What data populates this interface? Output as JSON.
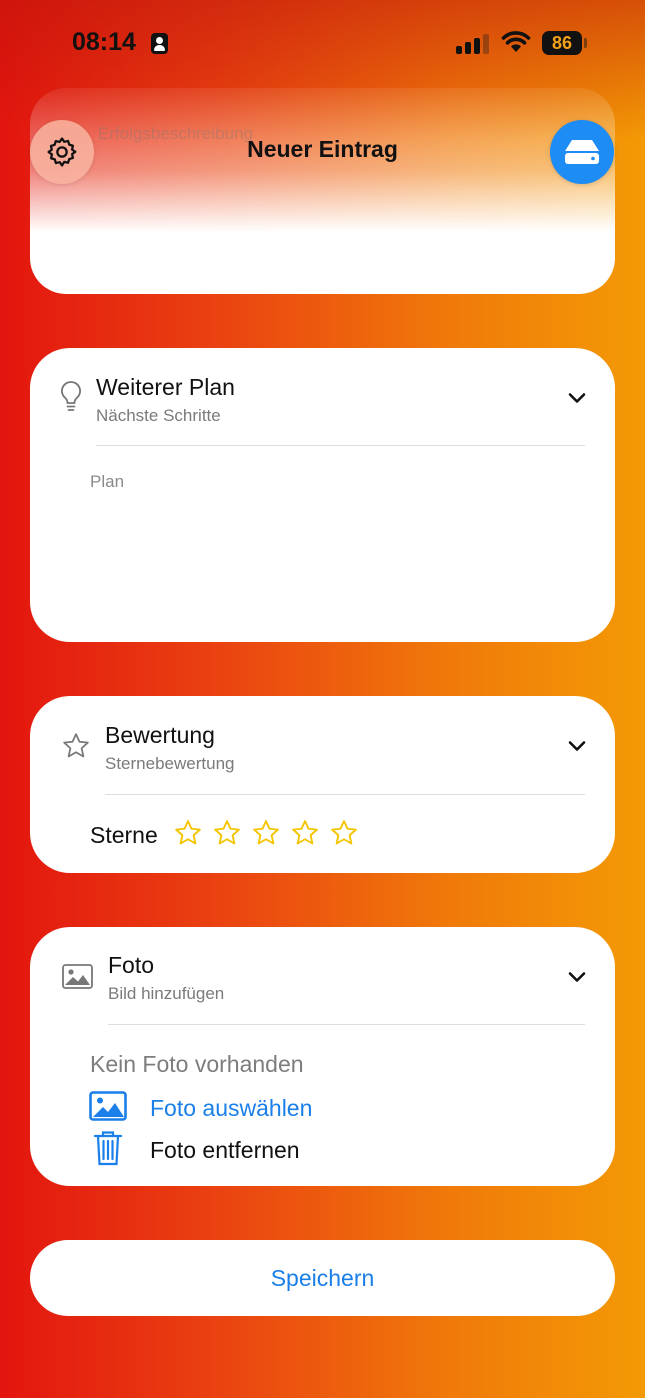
{
  "status_bar": {
    "time": "08:14",
    "battery": "86"
  },
  "header": {
    "title": "Neuer Eintrag",
    "ghost_text": "Erfolgsbeschreibung"
  },
  "sections": {
    "plan": {
      "title": "Weiterer Plan",
      "subtitle": "Nächste Schritte",
      "placeholder": "Plan",
      "icon": "lightbulb-icon"
    },
    "rating": {
      "title": "Bewertung",
      "subtitle": "Sternebewertung",
      "stars_label": "Sterne",
      "stars_value": 0,
      "stars_max": 5,
      "icon": "star-icon",
      "star_color": "#f5c400"
    },
    "photo": {
      "title": "Foto",
      "subtitle": "Bild hinzufügen",
      "empty_text": "Kein Foto vorhanden",
      "pick_label": "Foto auswählen",
      "remove_label": "Foto entfernen",
      "icon": "photo-icon"
    }
  },
  "save_label": "Speichern",
  "colors": {
    "accent": "#1a7fe8",
    "storage_button": "#1d8cf5"
  }
}
